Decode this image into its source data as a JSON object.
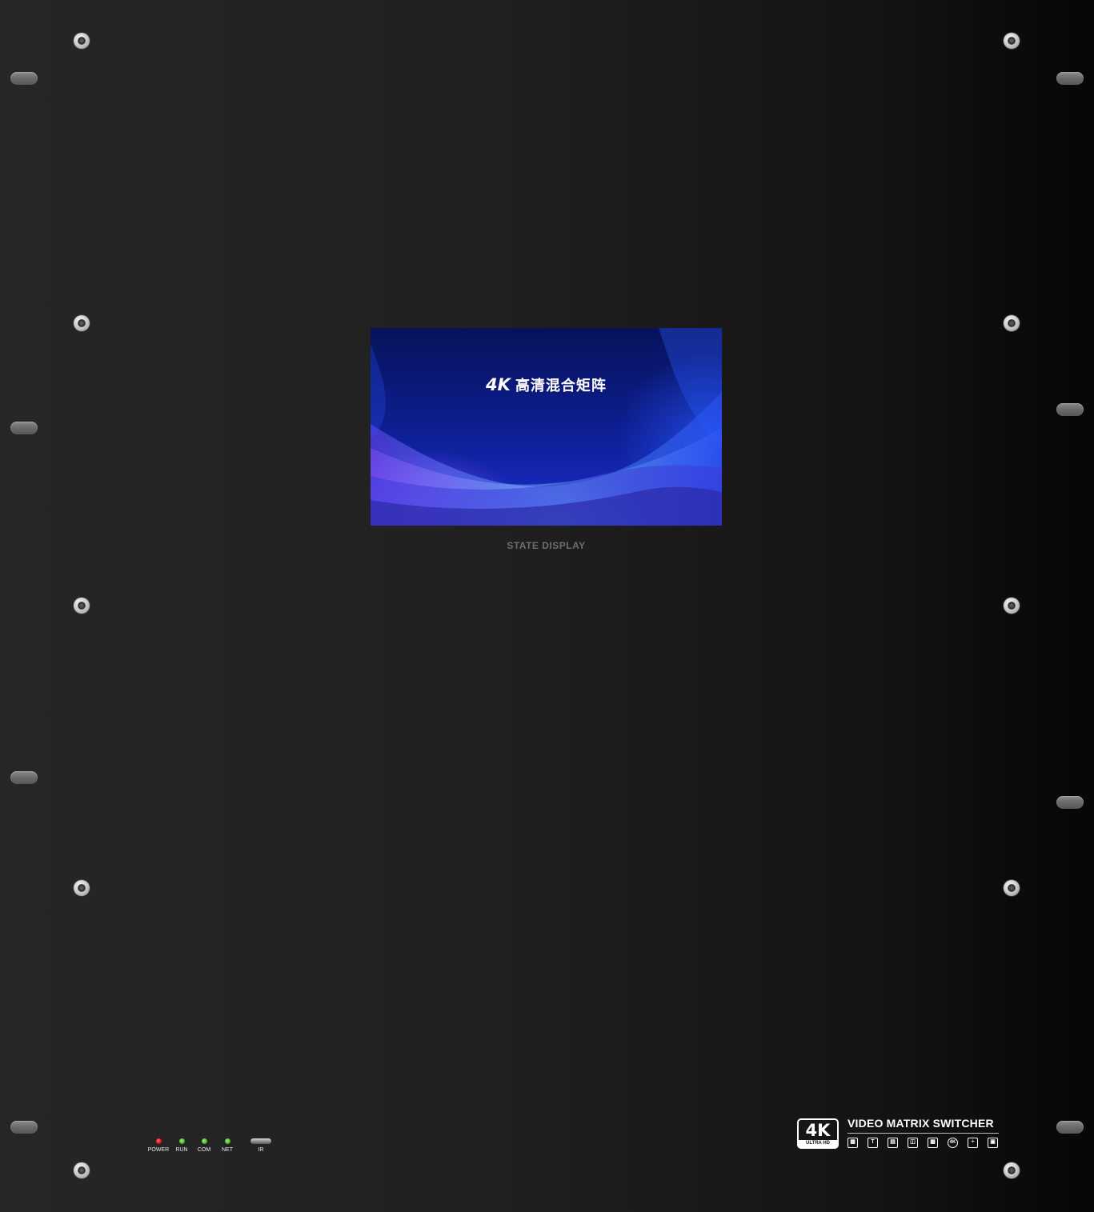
{
  "display": {
    "screen_title_4k": "4K",
    "screen_title_text": "高清混合矩阵",
    "label": "STATE DISPLAY"
  },
  "indicators": [
    {
      "label": "POWER",
      "color": "#e20000"
    },
    {
      "label": "RUN",
      "color": "#3cb018"
    },
    {
      "label": "COM",
      "color": "#3cb018"
    },
    {
      "label": "NET",
      "color": "#3cb018"
    }
  ],
  "ir": {
    "label": "IR"
  },
  "branding": {
    "logo_main": "4K",
    "logo_band": "ULTRA HD",
    "product_name": "VIDEO MATRIX SWITCHER",
    "feature_icons": [
      "layout-icon",
      "text-icon",
      "grid-icon",
      "split-icon",
      "matrix-icon",
      "4k-icon",
      "network-icon",
      "display-icon"
    ]
  },
  "colors": {
    "panel": "#222122",
    "screen_accent": "#3a6bff"
  }
}
